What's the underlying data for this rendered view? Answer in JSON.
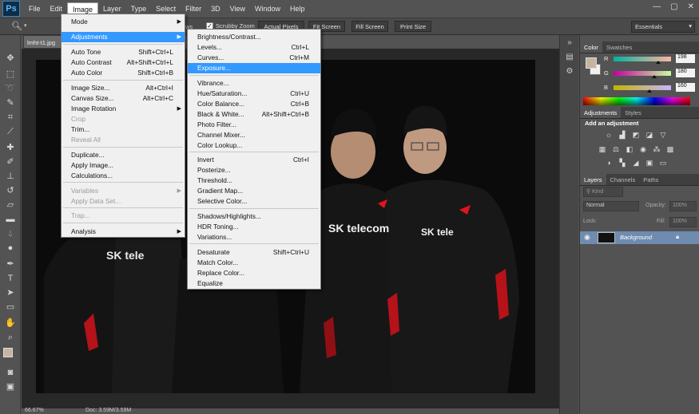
{
  "app": {
    "logo": "Ps"
  },
  "menubar": {
    "items": [
      "File",
      "Edit",
      "Image",
      "Layer",
      "Type",
      "Select",
      "Filter",
      "3D",
      "View",
      "Window",
      "Help"
    ],
    "active": "Image"
  },
  "window_controls": {
    "minimize": "—",
    "restore": "▢",
    "close": "✕"
  },
  "options_bar": {
    "ws_fragment": "ws",
    "scrubby_zoom": "Scrubby Zoom",
    "scrubby_checked": true,
    "buttons": [
      "Actual Pixels",
      "Fit Screen",
      "Fill Screen",
      "Print Size"
    ],
    "workspace": "Essentials"
  },
  "document": {
    "tab_title": "lmht-t1.jpg",
    "zoom": "66.67%",
    "doc_size": "Doc: 3.59M/3.59M"
  },
  "image_menu": {
    "items": [
      {
        "label": "Mode",
        "shortcut": "",
        "submenu": true,
        "disabled": false,
        "highlighted": false
      },
      {
        "label": "Adjustments",
        "shortcut": "",
        "submenu": true,
        "disabled": false,
        "highlighted": true
      },
      {
        "label": "Auto Tone",
        "shortcut": "Shift+Ctrl+L",
        "submenu": false,
        "disabled": false,
        "highlighted": false
      },
      {
        "label": "Auto Contrast",
        "shortcut": "Alt+Shift+Ctrl+L",
        "submenu": false,
        "disabled": false,
        "highlighted": false
      },
      {
        "label": "Auto Color",
        "shortcut": "Shift+Ctrl+B",
        "submenu": false,
        "disabled": false,
        "highlighted": false
      },
      {
        "label": "Image Size...",
        "shortcut": "Alt+Ctrl+I",
        "submenu": false,
        "disabled": false,
        "highlighted": false
      },
      {
        "label": "Canvas Size...",
        "shortcut": "Alt+Ctrl+C",
        "submenu": false,
        "disabled": false,
        "highlighted": false
      },
      {
        "label": "Image Rotation",
        "shortcut": "",
        "submenu": true,
        "disabled": false,
        "highlighted": false
      },
      {
        "label": "Crop",
        "shortcut": "",
        "submenu": false,
        "disabled": true,
        "highlighted": false
      },
      {
        "label": "Trim...",
        "shortcut": "",
        "submenu": false,
        "disabled": false,
        "highlighted": false
      },
      {
        "label": "Reveal All",
        "shortcut": "",
        "submenu": false,
        "disabled": true,
        "highlighted": false
      },
      {
        "label": "Duplicate...",
        "shortcut": "",
        "submenu": false,
        "disabled": false,
        "highlighted": false
      },
      {
        "label": "Apply Image...",
        "shortcut": "",
        "submenu": false,
        "disabled": false,
        "highlighted": false
      },
      {
        "label": "Calculations...",
        "shortcut": "",
        "submenu": false,
        "disabled": false,
        "highlighted": false
      },
      {
        "label": "Variables",
        "shortcut": "",
        "submenu": true,
        "disabled": true,
        "highlighted": false
      },
      {
        "label": "Apply Data Set...",
        "shortcut": "",
        "submenu": false,
        "disabled": true,
        "highlighted": false
      },
      {
        "label": "Trap...",
        "shortcut": "",
        "submenu": false,
        "disabled": true,
        "highlighted": false
      },
      {
        "label": "Analysis",
        "shortcut": "",
        "submenu": true,
        "disabled": false,
        "highlighted": false
      }
    ]
  },
  "adjustments_menu": {
    "items": [
      {
        "label": "Brightness/Contrast...",
        "shortcut": "",
        "highlighted": false
      },
      {
        "label": "Levels...",
        "shortcut": "Ctrl+L",
        "highlighted": false
      },
      {
        "label": "Curves...",
        "shortcut": "Ctrl+M",
        "highlighted": false
      },
      {
        "label": "Exposure...",
        "shortcut": "",
        "highlighted": true
      },
      {
        "label": "Vibrance...",
        "shortcut": "",
        "highlighted": false
      },
      {
        "label": "Hue/Saturation...",
        "shortcut": "Ctrl+U",
        "highlighted": false
      },
      {
        "label": "Color Balance...",
        "shortcut": "Ctrl+B",
        "highlighted": false
      },
      {
        "label": "Black & White...",
        "shortcut": "Alt+Shift+Ctrl+B",
        "highlighted": false
      },
      {
        "label": "Photo Filter...",
        "shortcut": "",
        "highlighted": false
      },
      {
        "label": "Channel Mixer...",
        "shortcut": "",
        "highlighted": false
      },
      {
        "label": "Color Lookup...",
        "shortcut": "",
        "highlighted": false
      },
      {
        "label": "Invert",
        "shortcut": "Ctrl+I",
        "highlighted": false
      },
      {
        "label": "Posterize...",
        "shortcut": "",
        "highlighted": false
      },
      {
        "label": "Threshold...",
        "shortcut": "",
        "highlighted": false
      },
      {
        "label": "Gradient Map...",
        "shortcut": "",
        "highlighted": false
      },
      {
        "label": "Selective Color...",
        "shortcut": "",
        "highlighted": false
      },
      {
        "label": "Shadows/Highlights...",
        "shortcut": "",
        "highlighted": false
      },
      {
        "label": "HDR Toning...",
        "shortcut": "",
        "highlighted": false
      },
      {
        "label": "Variations...",
        "shortcut": "",
        "highlighted": false
      },
      {
        "label": "Desaturate",
        "shortcut": "Shift+Ctrl+U",
        "highlighted": false
      },
      {
        "label": "Match Color...",
        "shortcut": "",
        "highlighted": false
      },
      {
        "label": "Replace Color...",
        "shortcut": "",
        "highlighted": false
      },
      {
        "label": "Equalize",
        "shortcut": "",
        "highlighted": false
      }
    ]
  },
  "color_panel": {
    "tabs": [
      "Color",
      "Swatches"
    ],
    "channels": [
      {
        "label": "R",
        "value": "198",
        "fraction": 0.776
      },
      {
        "label": "G",
        "value": "180",
        "fraction": 0.706
      },
      {
        "label": "B",
        "value": "160",
        "fraction": 0.627
      }
    ],
    "foreground": "#c6b4a0"
  },
  "adjustments_panel": {
    "tabs": [
      "Adjustments",
      "Styles"
    ],
    "title": "Add an adjustment"
  },
  "layers_panel": {
    "tabs": [
      "Layers",
      "Channels",
      "Paths"
    ],
    "filter": "Kind",
    "blend_mode": "Normal",
    "opacity_label": "Opacity:",
    "opacity": "100%",
    "lock_label": "Lock:",
    "fill_label": "Fill:",
    "fill": "100%",
    "layer_name": "Background"
  },
  "photo": {
    "jacket_text": "SK telecom",
    "jacket_text_short": "SK tele",
    "brand_color": "#e1141b",
    "background_color": "#0b0b0b"
  }
}
